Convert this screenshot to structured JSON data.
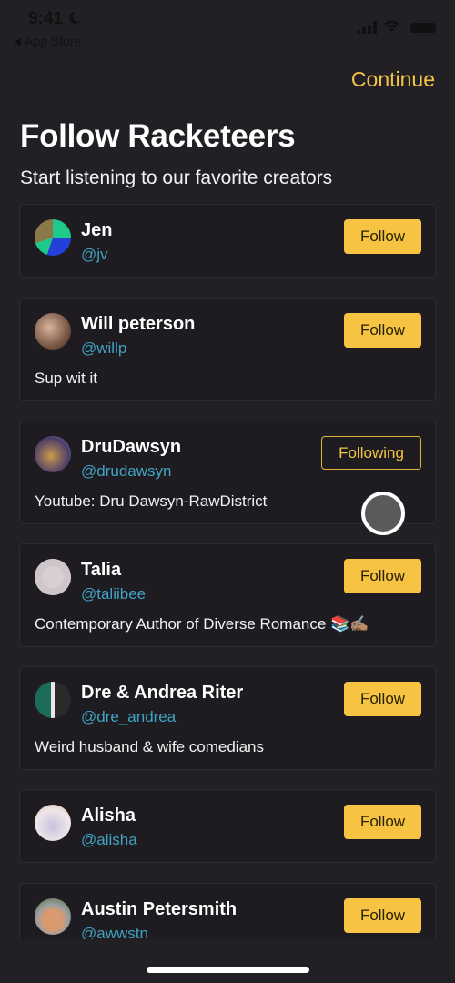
{
  "status_bar": {
    "time": "9:41",
    "back_label": "App Store",
    "icons": [
      "moon-icon",
      "signal-icon",
      "wifi-icon",
      "battery-icon"
    ]
  },
  "header": {
    "continue_label": "Continue",
    "title": "Follow Racketeers",
    "subtitle": "Start listening to our favorite creators"
  },
  "colors": {
    "accent": "#f6c343",
    "handle": "#3fa3c4",
    "background": "#222024"
  },
  "creators": [
    {
      "name": "Jen",
      "handle": "@jv",
      "bio": "",
      "button": "Follow",
      "following": false
    },
    {
      "name": "Will peterson",
      "handle": "@willp",
      "bio": "Sup wit it",
      "button": "Follow",
      "following": false
    },
    {
      "name": "DruDawsyn",
      "handle": "@drudawsyn",
      "bio": "Youtube: Dru Dawsyn-RawDistrict",
      "button": "Following",
      "following": true
    },
    {
      "name": "Talia",
      "handle": "@taliibee",
      "bio": "Contemporary Author of Diverse Romance 📚✍🏽",
      "button": "Follow",
      "following": false
    },
    {
      "name": "Dre & Andrea Riter",
      "handle": "@dre_andrea",
      "bio": "Weird husband & wife comedians",
      "button": "Follow",
      "following": false
    },
    {
      "name": "Alisha",
      "handle": "@alisha",
      "bio": "",
      "button": "Follow",
      "following": false
    },
    {
      "name": "Austin Petersmith",
      "handle": "@awwstn",
      "bio": "",
      "button": "Follow",
      "following": false
    }
  ]
}
